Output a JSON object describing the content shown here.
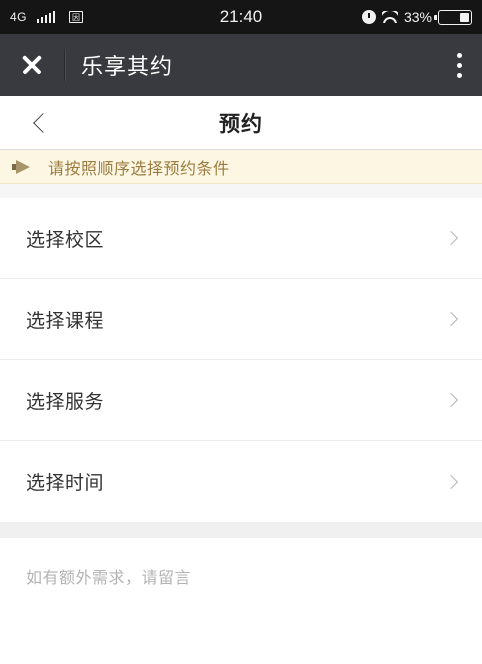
{
  "status_bar": {
    "network": "4G",
    "sim_label": "因",
    "time": "21:40",
    "battery_text": "33%",
    "battery_level": 0.33,
    "icons": [
      "signal-icon",
      "sim-icon",
      "alarm-icon",
      "wifi-icon",
      "battery-icon"
    ]
  },
  "app_bar": {
    "title": "乐享其约",
    "close_icon": "close-icon",
    "more_icon": "more-vertical-icon",
    "background": "#393a3f"
  },
  "nav": {
    "title": "预约",
    "back_icon": "chevron-left-icon"
  },
  "notice": {
    "text": "请按照顺序选择预约条件",
    "icon": "horn-icon",
    "text_color": "#9b7c3f",
    "background": "#fdf6e3"
  },
  "menu": {
    "items": [
      {
        "label": "选择校区"
      },
      {
        "label": "选择课程"
      },
      {
        "label": "选择服务"
      },
      {
        "label": "选择时间"
      }
    ],
    "item_icon": "chevron-right-icon"
  },
  "remark": {
    "placeholder": "如有额外需求，请留言",
    "value": ""
  }
}
